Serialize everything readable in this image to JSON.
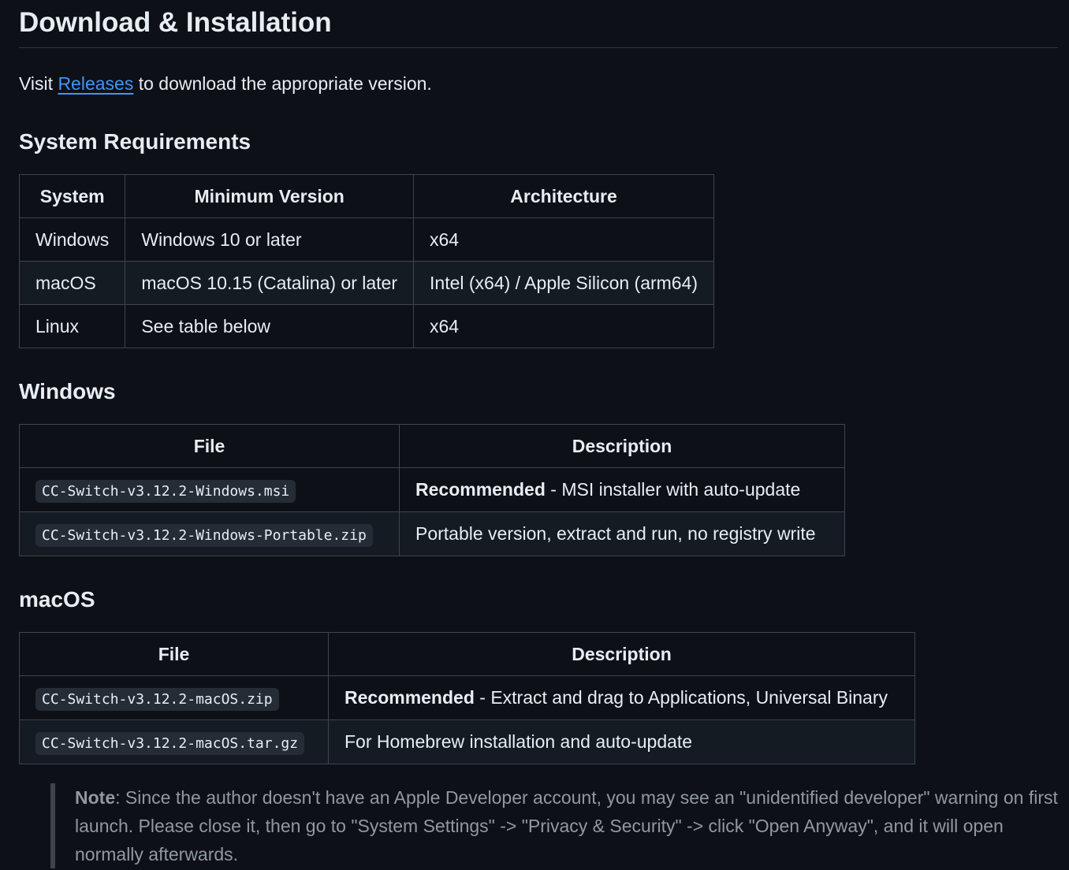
{
  "heading": "Download & Installation",
  "intro": {
    "prefix": "Visit ",
    "link_text": "Releases",
    "suffix": " to download the appropriate version."
  },
  "sysreq": {
    "title": "System Requirements",
    "headers": [
      "System",
      "Minimum Version",
      "Architecture"
    ],
    "rows": [
      [
        "Windows",
        "Windows 10 or later",
        "x64"
      ],
      [
        "macOS",
        "macOS 10.15 (Catalina) or later",
        "Intel (x64) / Apple Silicon (arm64)"
      ],
      [
        "Linux",
        "See table below",
        "x64"
      ]
    ]
  },
  "windows": {
    "title": "Windows",
    "headers": [
      "File",
      "Description"
    ],
    "rows": [
      {
        "file": "CC-Switch-v3.12.2-Windows.msi",
        "bold": "Recommended",
        "desc": " - MSI installer with auto-update"
      },
      {
        "file": "CC-Switch-v3.12.2-Windows-Portable.zip",
        "bold": "",
        "desc": "Portable version, extract and run, no registry write"
      }
    ]
  },
  "macos": {
    "title": "macOS",
    "headers": [
      "File",
      "Description"
    ],
    "rows": [
      {
        "file": "CC-Switch-v3.12.2-macOS.zip",
        "bold": "Recommended",
        "desc": " - Extract and drag to Applications, Universal Binary"
      },
      {
        "file": "CC-Switch-v3.12.2-macOS.tar.gz",
        "bold": "",
        "desc": "For Homebrew installation and auto-update"
      }
    ]
  },
  "note": {
    "label": "Note",
    "text": ": Since the author doesn't have an Apple Developer account, you may see an \"unidentified developer\" warning on first launch. Please close it, then go to \"System Settings\" -> \"Privacy & Security\" -> click \"Open Anyway\", and it will open normally afterwards."
  }
}
